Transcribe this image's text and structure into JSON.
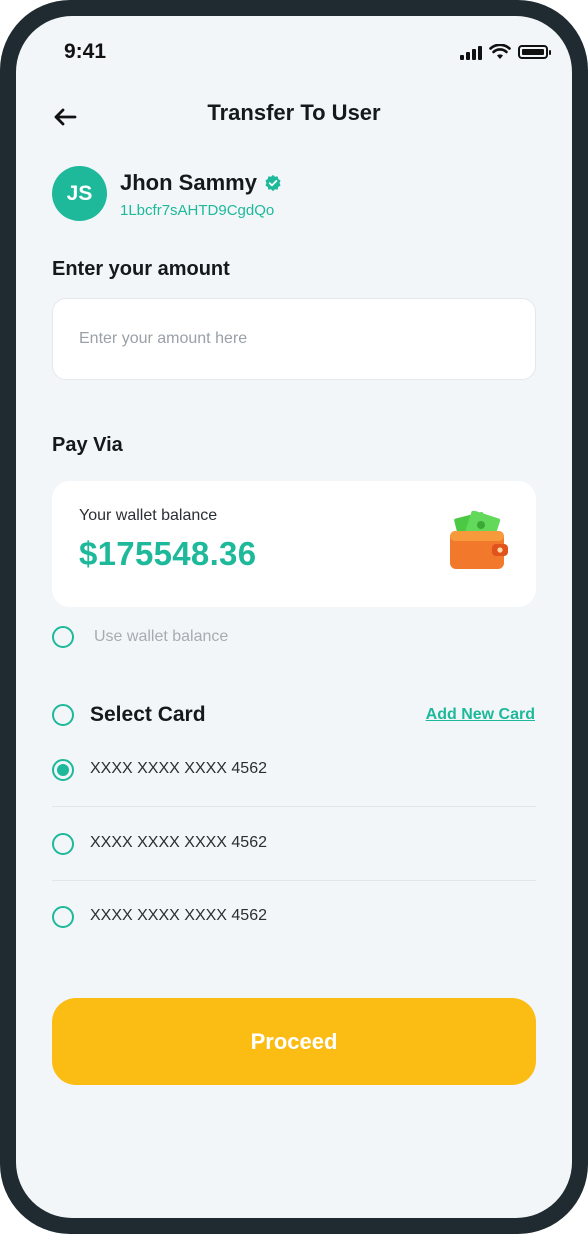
{
  "status_bar": {
    "time": "9:41"
  },
  "header": {
    "title": "Transfer To User"
  },
  "recipient": {
    "initials": "JS",
    "name": "Jhon Sammy",
    "wallet_id": "1Lbcfr7sAHTD9CgdQo"
  },
  "amount": {
    "label": "Enter your amount",
    "placeholder": "Enter your amount here",
    "value": ""
  },
  "pay_via": {
    "label": "Pay Via",
    "wallet_balance_label": "Your wallet balance",
    "wallet_balance_value": "$175548.36",
    "use_wallet_label": "Use wallet balance",
    "use_wallet_selected": false
  },
  "cards": {
    "label": "Select Card",
    "add_new_label": "Add New Card",
    "items": [
      {
        "number": "XXXX XXXX XXXX 4562",
        "selected": true
      },
      {
        "number": "XXXX XXXX XXXX 4562",
        "selected": false
      },
      {
        "number": "XXXX XXXX XXXX 4562",
        "selected": false
      }
    ]
  },
  "actions": {
    "proceed_label": "Proceed"
  },
  "colors": {
    "accent": "#1db99a",
    "button": "#fbbd14",
    "background": "#f3f6f9",
    "frame": "#1f2b30"
  },
  "icons": [
    "back-arrow-icon",
    "signal-icon",
    "wifi-icon",
    "battery-icon",
    "verified-badge-icon",
    "wallet-icon"
  ]
}
